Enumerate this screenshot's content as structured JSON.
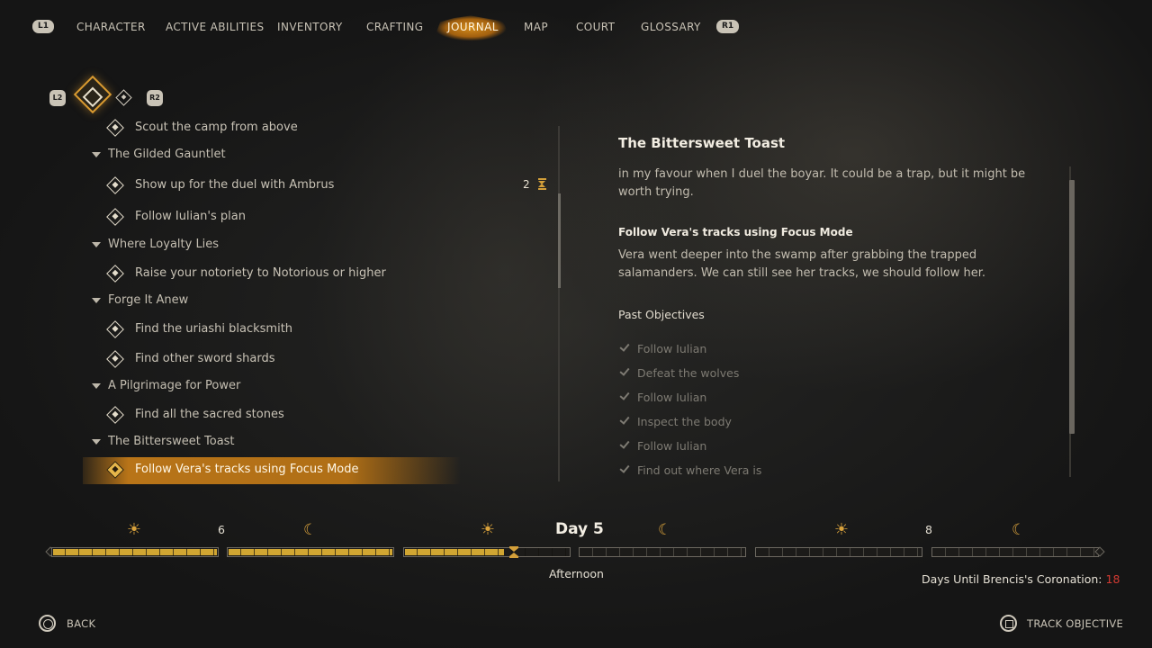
{
  "nav": {
    "left_bumper": "L1",
    "right_bumper": "R1",
    "tabs": [
      "CHARACTER",
      "ACTIVE ABILITIES",
      "INVENTORY",
      "CRAFTING",
      "JOURNAL",
      "MAP",
      "COURT",
      "GLOSSARY"
    ],
    "active_tab": "JOURNAL"
  },
  "filters": {
    "left_trigger": "L2",
    "right_trigger": "R2"
  },
  "quests": {
    "items": {
      "scout": "Scout the camp from above",
      "g1": "The Gilded Gauntlet",
      "duel": "Show up for the duel with Ambrus",
      "iulian_plan": "Follow Iulian's plan",
      "g2": "Where Loyalty Lies",
      "notoriety": "Raise your notoriety to Notorious or higher",
      "g3": "Forge It Anew",
      "blacksmith": "Find the uriashi blacksmith",
      "shards": "Find other sword shards",
      "g4": "A Pilgrimage for Power",
      "stones": "Find all the sacred stones",
      "g5": "The Bittersweet Toast",
      "vera": "Follow Vera's tracks using Focus Mode"
    },
    "timer_value": "2"
  },
  "detail": {
    "title": "The Bittersweet Toast",
    "intro": "in my favour when I duel the boyar. It could be a trap, but it might be worth trying.",
    "objective_title": "Follow Vera's tracks using Focus Mode",
    "objective_text": "Vera went deeper into the swamp after grabbing the trapped salamanders. We can still see her tracks, we should follow her.",
    "past_heading": "Past Objectives",
    "past": [
      "Follow Iulian",
      "Defeat the wolves",
      "Follow Iulian",
      "Inspect the body",
      "Follow Iulian",
      "Find out where Vera is"
    ]
  },
  "timeline": {
    "day_label": "Day 5",
    "time_of_day": "Afternoon",
    "prev_day": "6",
    "next_day": "8",
    "current_progress": 0.6,
    "coronation_label": "Days Until Brencis's Coronation:",
    "coronation_days": "18",
    "accent": "#d1a632",
    "alert": "#d23a32"
  },
  "footer": {
    "back_label": "BACK",
    "track_label": "TRACK OBJECTIVE"
  }
}
